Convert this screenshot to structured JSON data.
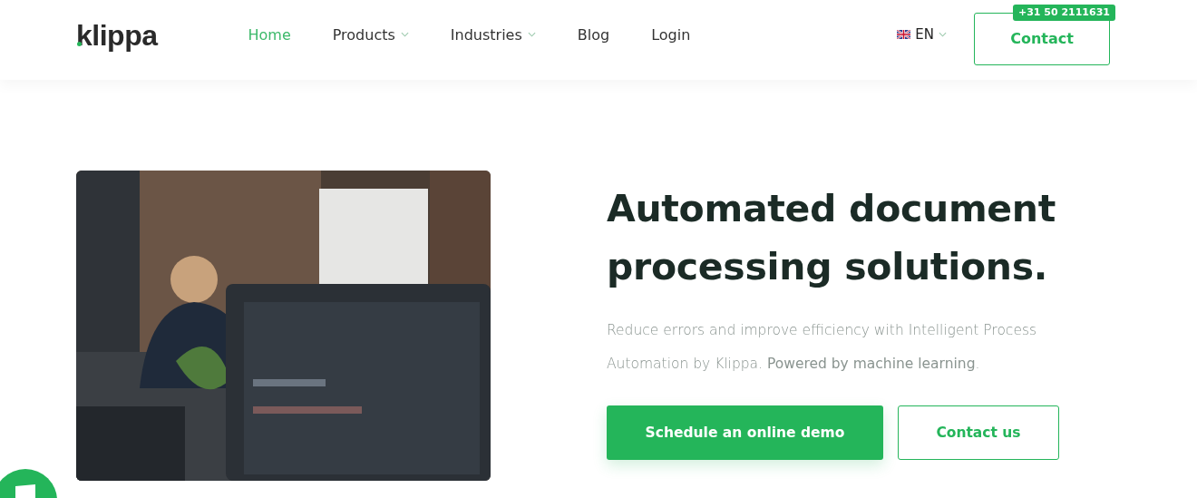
{
  "header": {
    "logo": "klippa",
    "nav": [
      {
        "label": "Home",
        "selected": true,
        "dropdown": false
      },
      {
        "label": "Products",
        "selected": false,
        "dropdown": true
      },
      {
        "label": "Industries",
        "selected": false,
        "dropdown": true
      },
      {
        "label": "Blog",
        "selected": false,
        "dropdown": false
      },
      {
        "label": "Login",
        "selected": false,
        "dropdown": false
      }
    ],
    "language": "EN",
    "contact_button": "Contact",
    "phone_badge": "+31 50 2111631"
  },
  "hero": {
    "heading": "Automated document processing solutions.",
    "text": "Reduce errors and improve efficiency with Intelligent Process Automation by Klippa. **Powered by machine learning**.",
    "buttons": [
      {
        "label": "Schedule an online demo",
        "kind": "primary"
      },
      {
        "label": "Contact us",
        "kind": "secondary"
      }
    ]
  }
}
